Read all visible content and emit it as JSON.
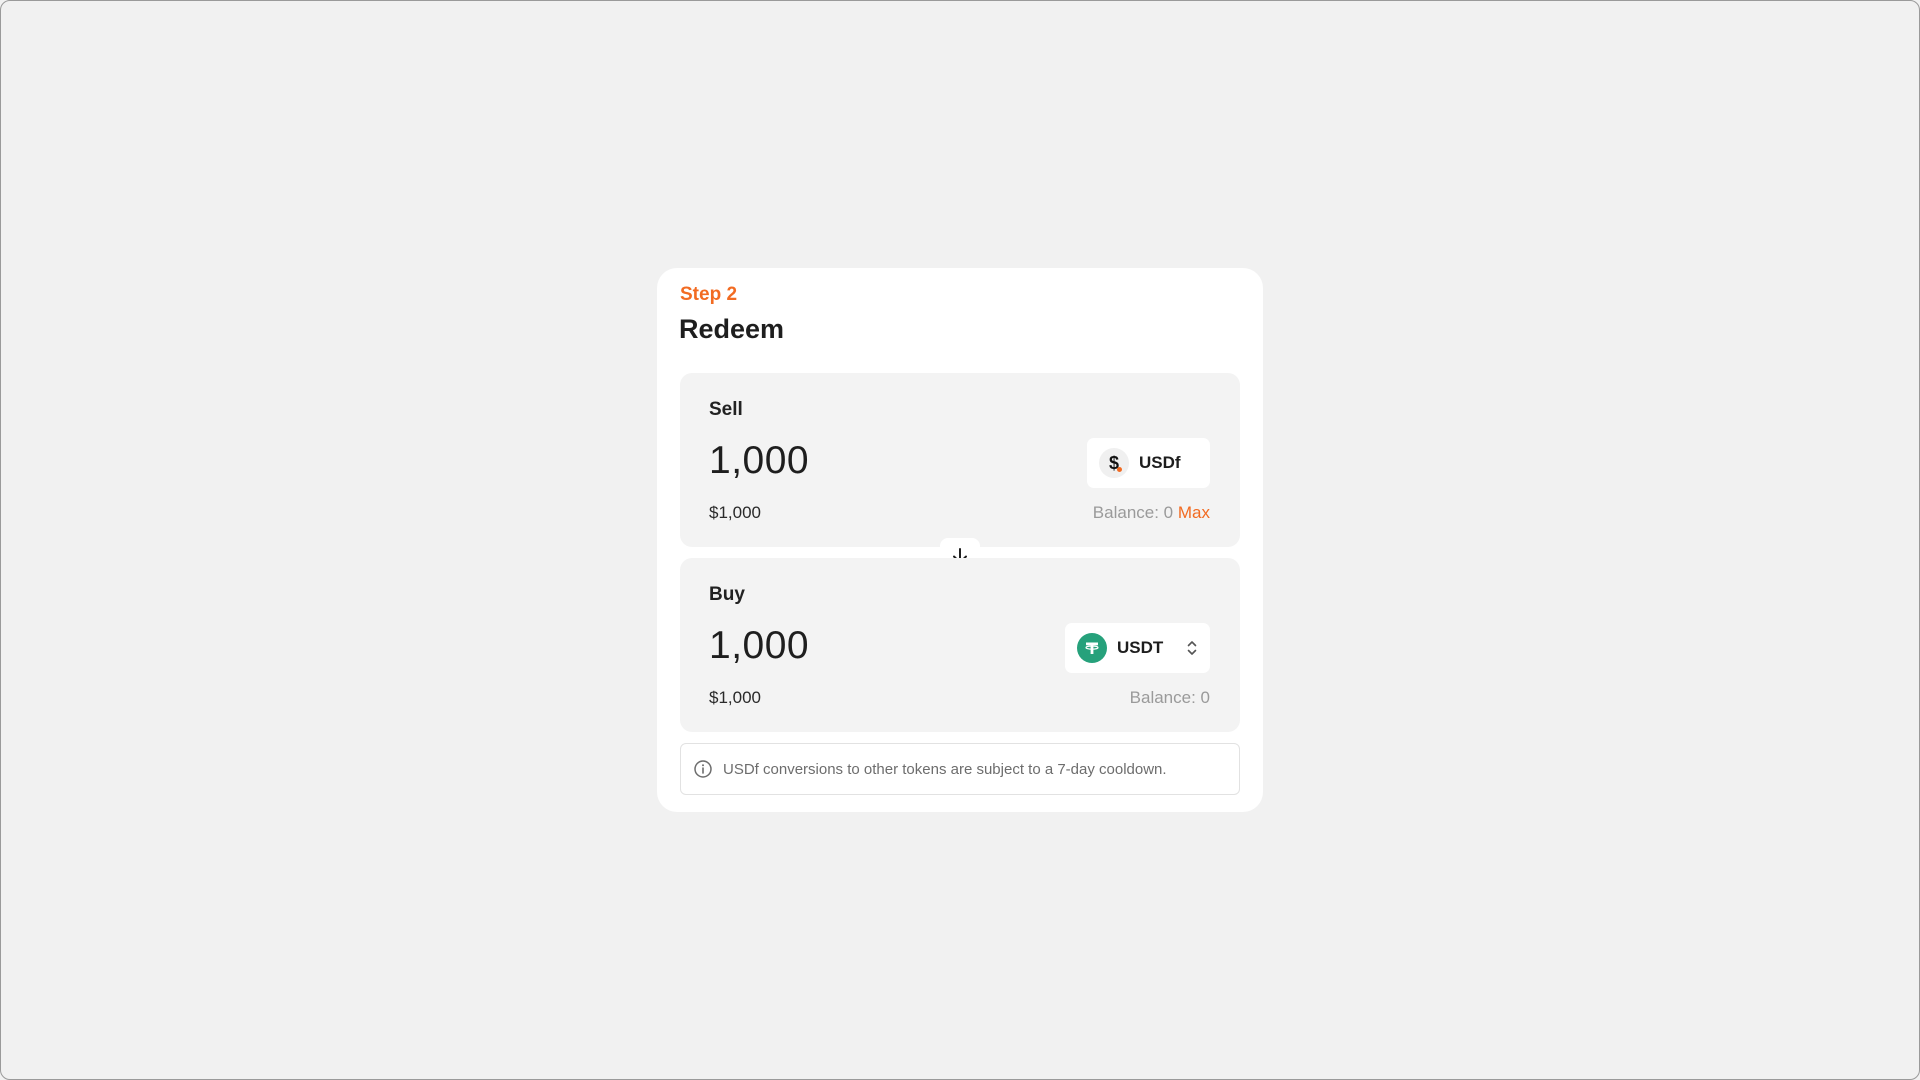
{
  "redeem": {
    "step_label": "Step 2",
    "title": "Redeem",
    "sell": {
      "label": "Sell",
      "amount": "1,000",
      "usd_value": "$1,000",
      "balance_label": "Balance: 0",
      "max_label": "Max",
      "token": {
        "symbol": "USDf",
        "icon": "usdf-dollar-icon"
      }
    },
    "swap_icon": "arrow-down-icon",
    "buy": {
      "label": "Buy",
      "amount": "1,000",
      "usd_value": "$1,000",
      "balance_label": "Balance: 0",
      "token": {
        "symbol": "USDT",
        "icon": "tether-icon",
        "selector_icon": "chevron-up-down-icon"
      }
    },
    "notice": {
      "icon": "info-icon",
      "text": "USDf conversions to other tokens are subject to a 7-day cooldown."
    }
  },
  "colors": {
    "accent": "#f26b22",
    "background": "#f1f1f1",
    "card": "#ffffff",
    "panel": "#f3f3f3",
    "usdt_green": "#26a17b",
    "muted_text": "#9a9a9a"
  }
}
